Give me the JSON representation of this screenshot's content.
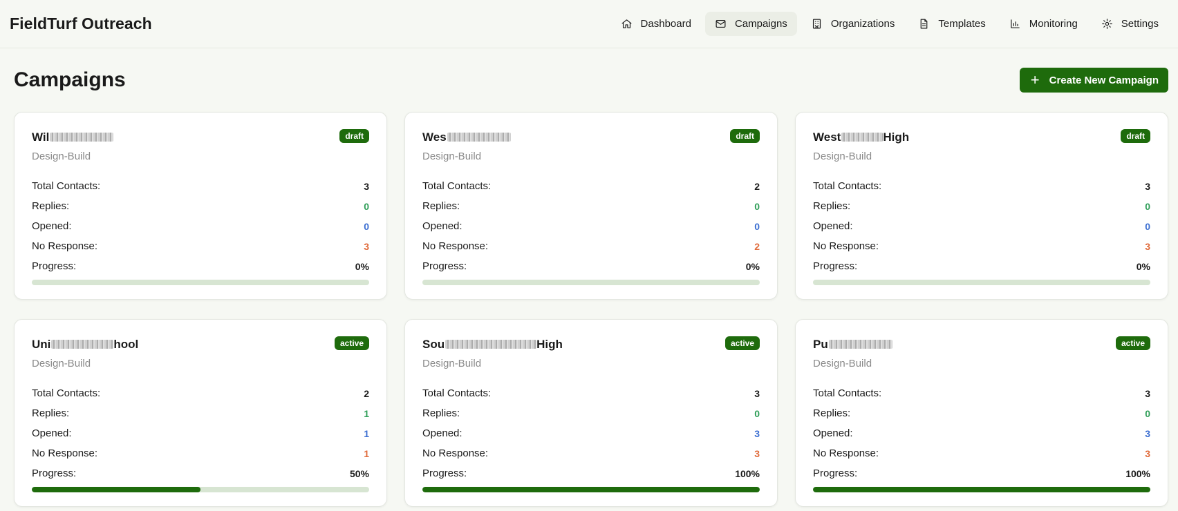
{
  "app": {
    "brand": "FieldTurf Outreach",
    "nav": [
      {
        "label": "Dashboard",
        "icon": "home-icon",
        "active": false
      },
      {
        "label": "Campaigns",
        "icon": "mail-icon",
        "active": true
      },
      {
        "label": "Organizations",
        "icon": "building-icon",
        "active": false
      },
      {
        "label": "Templates",
        "icon": "file-text-icon",
        "active": false
      },
      {
        "label": "Monitoring",
        "icon": "bar-chart-icon",
        "active": false
      },
      {
        "label": "Settings",
        "icon": "gear-icon",
        "active": false
      }
    ]
  },
  "page": {
    "title": "Campaigns",
    "create_button": "Create New Campaign"
  },
  "labels": {
    "total": "Total Contacts:",
    "replies": "Replies:",
    "opened": "Opened:",
    "no_response": "No Response:",
    "progress": "Progress:"
  },
  "colors": {
    "accent": "#1e6b0c",
    "replies": "#2f9e58",
    "opened": "#3b6ed1",
    "no_response": "#e06a3a",
    "bar_track": "#d7e5d2"
  },
  "campaigns": [
    {
      "name_start": "Wil",
      "name_end": "",
      "status": "draft",
      "type": "Design-Build",
      "total": "3",
      "replies": "0",
      "opened": "0",
      "no_response": "3",
      "progress_text": "0%",
      "progress": 0
    },
    {
      "name_start": "Wes",
      "name_end": "",
      "status": "draft",
      "type": "Design-Build",
      "total": "2",
      "replies": "0",
      "opened": "0",
      "no_response": "2",
      "progress_text": "0%",
      "progress": 0
    },
    {
      "name_start": "West",
      "name_end": "High",
      "status": "draft",
      "type": "Design-Build",
      "total": "3",
      "replies": "0",
      "opened": "0",
      "no_response": "3",
      "progress_text": "0%",
      "progress": 0
    },
    {
      "name_start": "Uni",
      "name_end": "hool",
      "status": "active",
      "type": "Design-Build",
      "total": "2",
      "replies": "1",
      "opened": "1",
      "no_response": "1",
      "progress_text": "50%",
      "progress": 50
    },
    {
      "name_start": "Sou",
      "name_end": "High",
      "status": "active",
      "type": "Design-Build",
      "total": "3",
      "replies": "0",
      "opened": "3",
      "no_response": "3",
      "progress_text": "100%",
      "progress": 100
    },
    {
      "name_start": "Pu",
      "name_end": "",
      "status": "active",
      "type": "Design-Build",
      "total": "3",
      "replies": "0",
      "opened": "3",
      "no_response": "3",
      "progress_text": "100%",
      "progress": 100
    }
  ]
}
